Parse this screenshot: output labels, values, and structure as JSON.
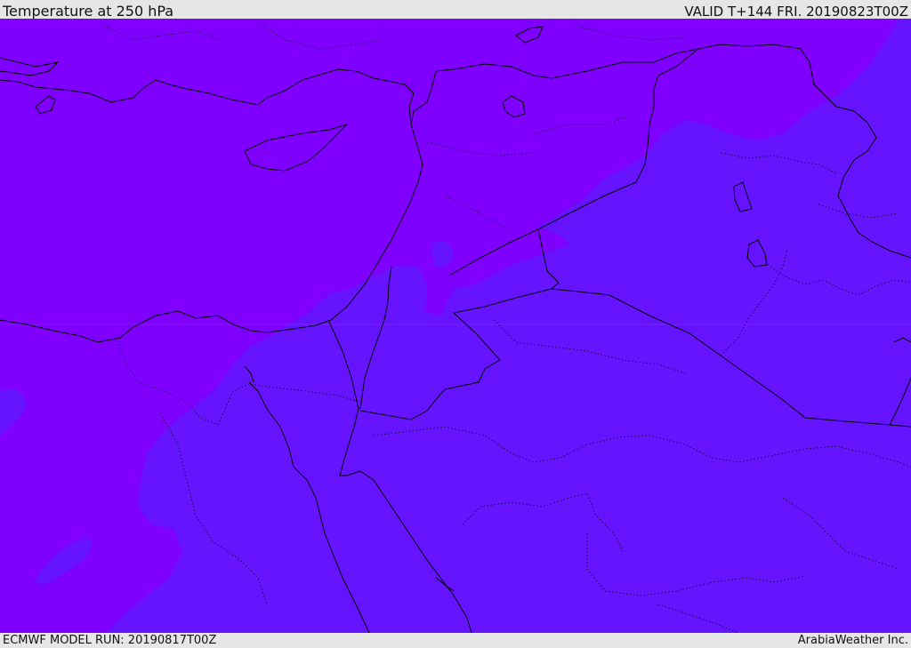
{
  "header": {
    "title": "Temperature at 250 hPa",
    "valid_time": "VALID T+144 FRI. 20190823T00Z"
  },
  "footer": {
    "model_run": "ECMWF MODEL RUN: 20190817T00Z",
    "credit": "ArabiaWeather Inc."
  },
  "colors": {
    "warmer_field": "#8000ff",
    "cooler_field": "#6614ff",
    "coastline": "#000000",
    "borders": "#000000"
  }
}
